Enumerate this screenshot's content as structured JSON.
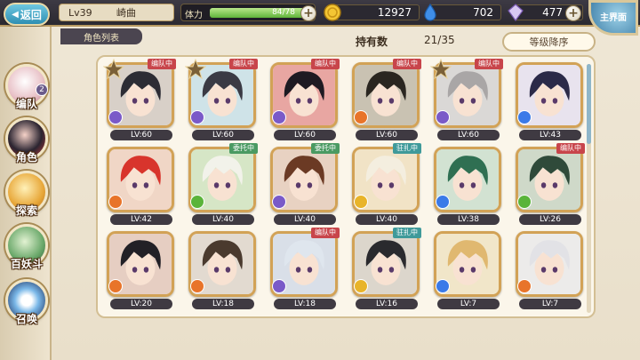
{
  "topbar": {
    "back_label": "返回",
    "level": "Lv39",
    "player_name": "崎曲",
    "stamina_label": "体力",
    "stamina_value": "84/78",
    "gold": "12927",
    "water": "702",
    "gem": "477",
    "home_label": "主界面"
  },
  "nav": [
    {
      "label": "编队",
      "badge": "2"
    },
    {
      "label": "角色"
    },
    {
      "label": "探索"
    },
    {
      "label": "百妖斗"
    },
    {
      "label": "召唤"
    }
  ],
  "list_tab": "角色列表",
  "owned_label": "持有数",
  "owned_count": "21/35",
  "sort_label": "等级降序",
  "colors": {
    "tag_red": "#c8454b",
    "tag_green": "#4a9a62",
    "tag_teal": "#3f9a9a",
    "frame_gold": "#d2a256"
  },
  "cards": [
    {
      "level": "LV:60",
      "tag": "编队中",
      "tag_color": "red",
      "star": true,
      "element": "purple",
      "hair": "#2c2c34",
      "bg": "#d8d0c8"
    },
    {
      "level": "LV:60",
      "tag": "编队中",
      "tag_color": "red",
      "star": true,
      "element": "purple",
      "hair": "#3a3a44",
      "bg": "#cfe3e8"
    },
    {
      "level": "LV:60",
      "tag": "编队中",
      "tag_color": "red",
      "star": false,
      "element": "purple",
      "hair": "#1e1a22",
      "bg": "#e8a6a2"
    },
    {
      "level": "LV:60",
      "tag": "编队中",
      "tag_color": "red",
      "star": false,
      "element": "orange",
      "hair": "#2a2620",
      "bg": "#c9c2b2"
    },
    {
      "level": "LV:60",
      "tag": "编队中",
      "tag_color": "red",
      "star": true,
      "element": "purple",
      "hair": "#a9a6a6",
      "bg": "#dad8d6"
    },
    {
      "level": "LV:43",
      "tag": "",
      "tag_color": "",
      "star": false,
      "element": "blue",
      "hair": "#2b2a48",
      "bg": "#e8e3ee"
    },
    {
      "level": "LV:42",
      "tag": "",
      "tag_color": "",
      "star": false,
      "element": "orange",
      "hair": "#d8342c",
      "bg": "#f0d6c6"
    },
    {
      "level": "LV:40",
      "tag": "委托中",
      "tag_color": "green",
      "star": false,
      "element": "green",
      "hair": "#f2f2ea",
      "bg": "#d6e6c6"
    },
    {
      "level": "LV:40",
      "tag": "委托中",
      "tag_color": "green",
      "star": false,
      "element": "purple",
      "hair": "#6b3a24",
      "bg": "#e8d2c2"
    },
    {
      "level": "LV:40",
      "tag": "驻扎中",
      "tag_color": "teal",
      "star": false,
      "element": "gold",
      "hair": "#f4eedf",
      "bg": "#f1e3c6"
    },
    {
      "level": "LV:38",
      "tag": "",
      "tag_color": "",
      "star": false,
      "element": "blue",
      "hair": "#2f6f52",
      "bg": "#d2e2d2"
    },
    {
      "level": "LV:26",
      "tag": "编队中",
      "tag_color": "red",
      "star": false,
      "element": "green",
      "hair": "#2f4a3a",
      "bg": "#cfd9c9"
    },
    {
      "level": "LV:20",
      "tag": "",
      "tag_color": "",
      "star": false,
      "element": "orange",
      "hair": "#222026",
      "bg": "#e6cec2"
    },
    {
      "level": "LV:18",
      "tag": "",
      "tag_color": "",
      "star": false,
      "element": "orange",
      "hair": "#4a3a2e",
      "bg": "#e2dad0"
    },
    {
      "level": "LV:18",
      "tag": "编队中",
      "tag_color": "red",
      "star": false,
      "element": "purple",
      "hair": "#dfe6ee",
      "bg": "#d9dfe8"
    },
    {
      "level": "LV:16",
      "tag": "驻扎中",
      "tag_color": "teal",
      "star": false,
      "element": "gold",
      "hair": "#2a2a2e",
      "bg": "#dcd6cc"
    },
    {
      "level": "LV:7",
      "tag": "",
      "tag_color": "",
      "star": false,
      "element": "blue",
      "hair": "#e0b870",
      "bg": "#f1e6c9"
    },
    {
      "level": "LV:7",
      "tag": "",
      "tag_color": "",
      "star": false,
      "element": "orange",
      "hair": "#e2e2e6",
      "bg": "#ecebea"
    }
  ]
}
